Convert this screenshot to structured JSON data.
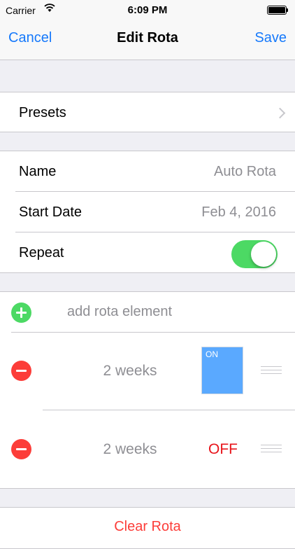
{
  "status_bar": {
    "carrier": "Carrier",
    "time": "6:09 PM"
  },
  "nav": {
    "cancel": "Cancel",
    "title": "Edit Rota",
    "save": "Save"
  },
  "presets": {
    "label": "Presets"
  },
  "details": {
    "name_label": "Name",
    "name_value": "Auto Rota",
    "start_label": "Start Date",
    "start_value": "Feb 4, 2016",
    "repeat_label": "Repeat",
    "repeat_on": true
  },
  "elements": {
    "add_placeholder": "add rota element",
    "rows": [
      {
        "duration": "2 weeks",
        "state_label": "ON",
        "on": true
      },
      {
        "duration": "2 weeks",
        "state_label": "OFF",
        "on": false
      }
    ]
  },
  "footer": {
    "clear_label": "Clear Rota"
  },
  "colors": {
    "accent": "#1679fb",
    "toggle_green": "#4cd964",
    "delete_red": "#fc3d39",
    "on_blue": "#5aa9ff",
    "off_red": "#e8141b"
  },
  "icons": [
    "wifi-icon",
    "battery-icon",
    "chevron-right-icon",
    "add-circle-icon",
    "remove-circle-icon",
    "reorder-grip-icon"
  ]
}
